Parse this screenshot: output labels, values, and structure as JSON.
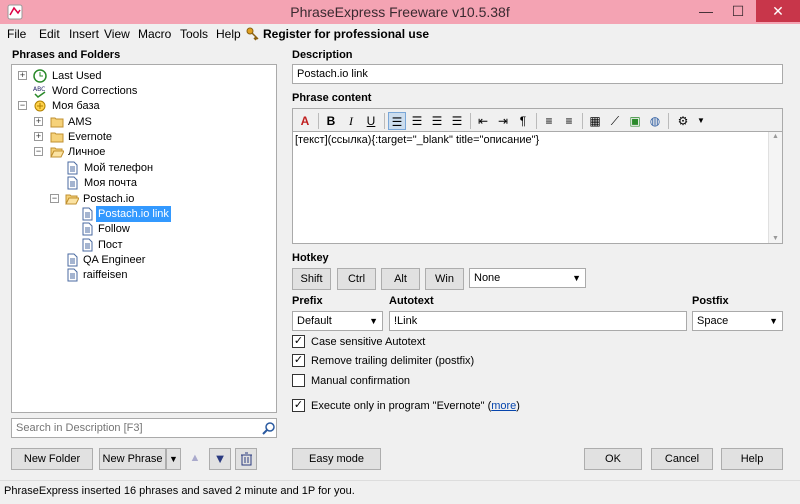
{
  "window": {
    "title": "PhraseExpress Freeware v10.5.38f",
    "minimize_label": "—",
    "maximize_label": "☐",
    "close_label": "✕"
  },
  "menu": {
    "items": [
      "File",
      "Edit",
      "Insert",
      "View",
      "Macro",
      "Tools",
      "Help"
    ],
    "register_label": "Register for professional use"
  },
  "left": {
    "title": "Phrases and Folders",
    "tree": [
      {
        "label": "Last Used",
        "icon": "clock-icon",
        "expander": "+"
      },
      {
        "label": "Word Corrections",
        "icon": "abc-icon"
      },
      {
        "label": "Моя база",
        "icon": "database-icon",
        "expander": "−"
      },
      {
        "label": "AMS",
        "icon": "folder-icon",
        "expander": "+"
      },
      {
        "label": "Evernote",
        "icon": "folder-icon",
        "expander": "+"
      },
      {
        "label": "Личное",
        "icon": "folder-open-icon",
        "expander": "−"
      },
      {
        "label": "Мой телефон",
        "icon": "document-icon"
      },
      {
        "label": "Моя почта",
        "icon": "document-icon"
      },
      {
        "label": "Postach.io",
        "icon": "folder-open-icon",
        "expander": "−"
      },
      {
        "label": "Postach.io link",
        "icon": "document-icon",
        "selected": true
      },
      {
        "label": "Follow",
        "icon": "document-icon"
      },
      {
        "label": "Пост",
        "icon": "document-icon"
      },
      {
        "label": "QA Engineer",
        "icon": "document-icon"
      },
      {
        "label": "raiffeisen",
        "icon": "document-icon"
      }
    ],
    "search_placeholder": "Search in Description [F3]",
    "new_folder_label": "New Folder",
    "new_phrase_label": "New Phrase"
  },
  "right": {
    "description_label": "Description",
    "description_value": "Postach.io link",
    "content_label": "Phrase content",
    "content_text": "[текст](ссылка){:target=\"_blank\" title=\"описание\"}",
    "hotkey_label": "Hotkey",
    "hotkey_buttons": [
      "Shift",
      "Ctrl",
      "Alt",
      "Win"
    ],
    "hotkey_value": "None",
    "prefix_label": "Prefix",
    "prefix_value": "Default",
    "autotext_label": "Autotext",
    "autotext_value": "!Link",
    "postfix_label": "Postfix",
    "postfix_value": "Space",
    "checkboxes": [
      {
        "label": "Case sensitive Autotext",
        "checked": true
      },
      {
        "label": "Remove trailing delimiter (postfix)",
        "checked": true
      },
      {
        "label": "Manual confirmation",
        "checked": false
      },
      {
        "label": "Execute only in program \"Evernote\" (",
        "link": "more",
        "suffix": ")",
        "checked": true
      }
    ],
    "easy_mode_label": "Easy mode",
    "ok_label": "OK",
    "cancel_label": "Cancel",
    "help_label": "Help"
  },
  "status": {
    "text": "PhraseExpress inserted 16 phrases and saved 2 minute and 1P for you."
  },
  "colors": {
    "titlebar": "#f4a3b3",
    "close": "#c8364a",
    "selection": "#3399ff",
    "link": "#0645ad"
  }
}
